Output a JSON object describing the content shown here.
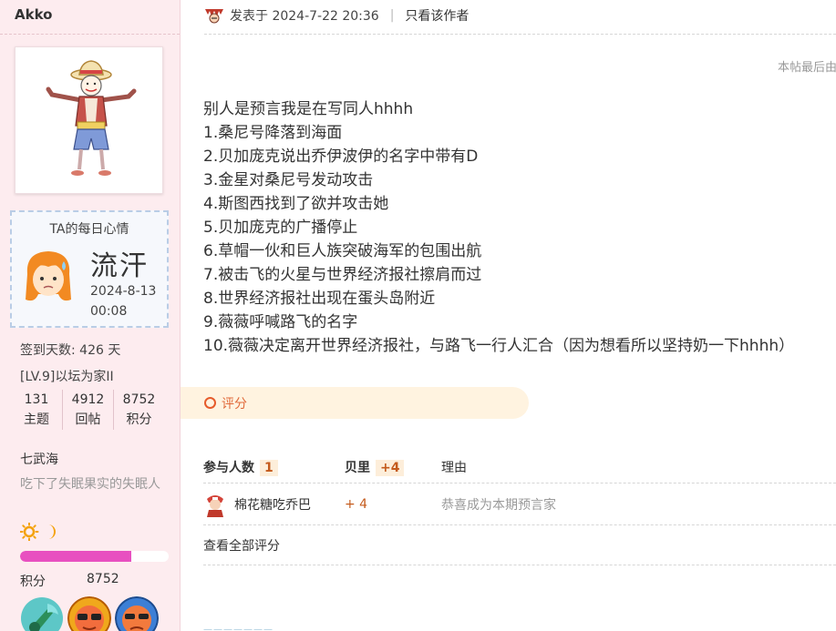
{
  "user": {
    "name": "Akko",
    "mood": {
      "title": "TA的每日心情",
      "word": "流汗",
      "date": "2024-8-13",
      "time": "00:08"
    },
    "checkin": "签到天数: 426 天",
    "level": "[LV.9]以坛为家II",
    "stats": [
      {
        "value": "131",
        "label": "主题"
      },
      {
        "value": "4912",
        "label": "回帖"
      },
      {
        "value": "8752",
        "label": "积分"
      }
    ],
    "rank": "七武海",
    "rank_desc": "吃下了失眠果实的失眠人",
    "level_progress": 0.75,
    "points_label": "积分",
    "points_value": "8752",
    "medal_icons": [
      "guitar-dragon-medal-icon",
      "sunglasses-face-medal-icon",
      "grumpy-face-medal-icon"
    ]
  },
  "post": {
    "meta_posted": "发表于 2024-7-22 20:36",
    "meta_sep": "|",
    "meta_only_author": "只看该作者",
    "edit_note": "本帖最后由",
    "lines": [
      "别人是预言我是在写同人hhhh",
      "1.桑尼号降落到海面",
      "2.贝加庞克说出乔伊波伊的名字中带有D",
      "3.金星对桑尼号发动攻击",
      "4.斯图西找到了欲并攻击她",
      "5.贝加庞克的广播停止",
      "6.草帽一伙和巨人族突破海军的包围出航",
      "7.被击飞的火星与世界经济报社擦肩而过",
      "8.世界经济报社出现在蛋头岛附近",
      "9.薇薇呼喊路飞的名字",
      "10.薇薇决定离开世界经济报社，与路飞一行人汇合（因为想看所以坚持奶一下hhhh）"
    ]
  },
  "rating": {
    "button_label": "评分",
    "head_participants": "参与人数",
    "head_participants_count": "1",
    "head_currency": "贝里",
    "head_currency_total": "+4",
    "head_reason": "理由",
    "rows": [
      {
        "user": "棉花糖吃乔巴",
        "amount": "+ 4",
        "reason": "恭喜成为本期预言家"
      }
    ],
    "view_all": "查看全部评分"
  },
  "colors": {
    "sidebar_bg": "#fdecef",
    "accent_orange": "#e06a3a",
    "progress_pink": "#e850c0",
    "badge_bg": "#fdeeda"
  }
}
